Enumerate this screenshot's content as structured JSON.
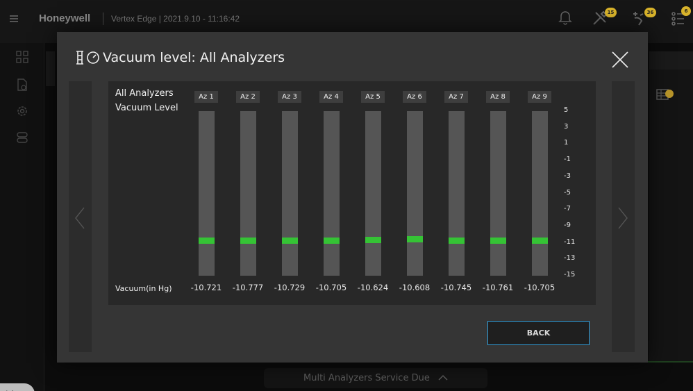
{
  "header": {
    "brand": "Honeywell",
    "title": "Vertex Edge | 2021.9.10 - 11:16:42",
    "badges": {
      "tools": "15",
      "maintenance": "36",
      "tasks": "6"
    }
  },
  "sidebar": {
    "user_initials": "Adm"
  },
  "footer": {
    "service_due": "Multi Analyzers Service Due"
  },
  "modal": {
    "title": "Vacuum level: All Analyzers",
    "chart_label_line1": "All Analyzers",
    "chart_label_line2": "Vacuum Level",
    "unit_label": "Vacuum(in Hg)",
    "back_label": "BACK"
  },
  "colors": {
    "level_marker": "#35c335",
    "bar_track": "#555555",
    "button_border": "#31a2e0",
    "badge": "#d8b32b"
  },
  "chart_data": {
    "type": "bar",
    "categories": [
      "Az 1",
      "Az 2",
      "Az 3",
      "Az 4",
      "Az 5",
      "Az 6",
      "Az 7",
      "Az 8",
      "Az 9"
    ],
    "values": [
      -10.721,
      -10.777,
      -10.729,
      -10.705,
      -10.624,
      -10.608,
      -10.745,
      -10.761,
      -10.705
    ],
    "value_labels": [
      "-10.721",
      "-10.777",
      "-10.729",
      "-10.705",
      "-10.624",
      "-10.608",
      "-10.745",
      "-10.761",
      "-10.705"
    ],
    "yticks": [
      "5",
      "3",
      "1",
      "-1",
      "-3",
      "-5",
      "-7",
      "-9",
      "-11",
      "-13",
      "-15"
    ],
    "ylim": [
      -15,
      5
    ],
    "ylabel": "Vacuum(in Hg)",
    "grid": false
  }
}
